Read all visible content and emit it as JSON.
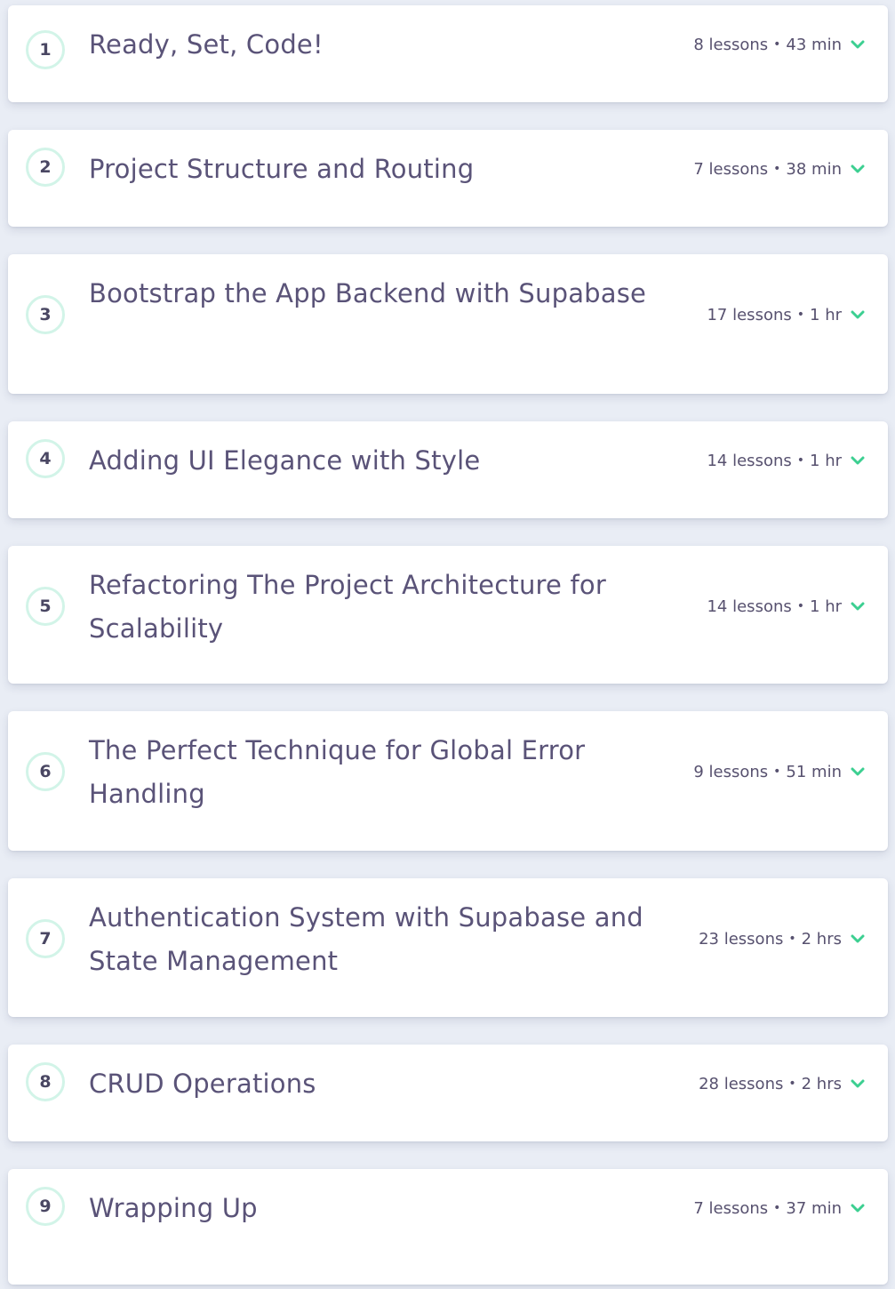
{
  "sections": [
    {
      "number": "1",
      "title": "Ready, Set, Code!",
      "lessons": "8 lessons",
      "duration": "43 min"
    },
    {
      "number": "2",
      "title": "Project Structure and Routing",
      "lessons": "7 lessons",
      "duration": "38 min"
    },
    {
      "number": "3",
      "title": "Bootstrap the App Backend with Supabase",
      "lessons": "17 lessons",
      "duration": "1 hr"
    },
    {
      "number": "4",
      "title": "Adding UI Elegance with Style",
      "lessons": "14 lessons",
      "duration": "1 hr"
    },
    {
      "number": "5",
      "title": "Refactoring The Project Architecture for Scalability",
      "lessons": "14 lessons",
      "duration": "1 hr"
    },
    {
      "number": "6",
      "title": "The Perfect Technique for Global Error Handling",
      "lessons": "9 lessons",
      "duration": "51 min"
    },
    {
      "number": "7",
      "title": "Authentication System with Supabase and State Management",
      "lessons": "23 lessons",
      "duration": "2 hrs"
    },
    {
      "number": "8",
      "title": "CRUD Operations",
      "lessons": "28 lessons",
      "duration": "2 hrs"
    },
    {
      "number": "9",
      "title": "Wrapping Up",
      "lessons": "7 lessons",
      "duration": "37 min"
    }
  ],
  "meta_separator": "•",
  "icons": {
    "expand": "chevron-down-icon"
  },
  "colors": {
    "background": "#e9edf5",
    "card": "#ffffff",
    "number_ring": "#d2f4e8",
    "title_text": "#5a5378",
    "accent_chevron": "#3ccf91"
  }
}
